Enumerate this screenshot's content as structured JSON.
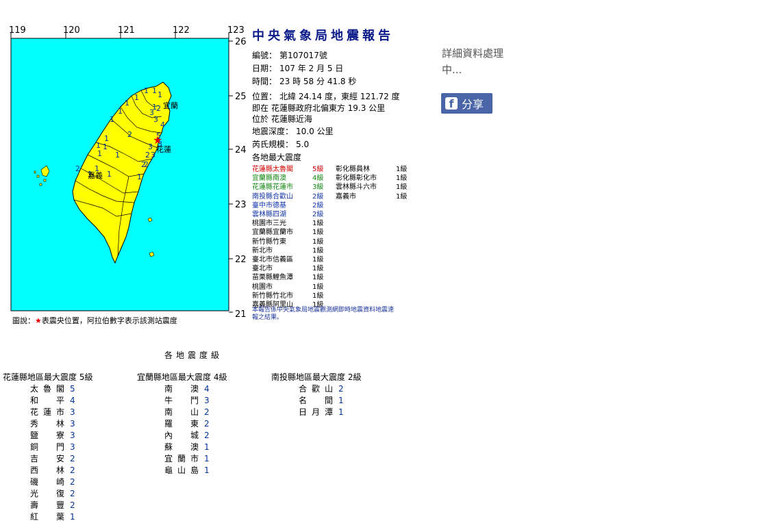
{
  "map": {
    "lon_labels": [
      "119",
      "120",
      "121",
      "122",
      "123"
    ],
    "lat_labels": [
      "26",
      "25",
      "24",
      "23",
      "22",
      "21"
    ],
    "colors": {
      "land": "#ffff00",
      "sea": "#00ffff",
      "star": "#e00000",
      "station": "#003399"
    },
    "city_labels": [
      "宜蘭",
      "花蓮",
      "嘉義"
    ],
    "legend_prefix": "圖說：",
    "legend_star": "★",
    "legend_text": "表震央位置，阿拉伯數字表示該測站震度"
  },
  "report": {
    "title": "中央氣象局地震報告",
    "rows": [
      {
        "k": "編號：",
        "v": "第107017號"
      },
      {
        "k": "日期：",
        "v": "107 年 2 月 5 日"
      },
      {
        "k": "時間：",
        "v": "23 時 58 分 41.8 秒"
      },
      {
        "k": "位置：",
        "v": "北緯 24.14 度，東經 121.72 度"
      },
      {
        "k": "",
        "v": "即在 花蓮縣政府北偏東方 19.3 公里"
      },
      {
        "k": "",
        "v": "位於 花蓮縣近海"
      },
      {
        "k": "地震深度：",
        "v": "10.0 公里"
      },
      {
        "k": "芮氏規模：",
        "v": "5.0"
      },
      {
        "k": "",
        "v": "各地最大震度"
      }
    ],
    "intensity_col1": [
      {
        "name": "花蓮縣太魯閣",
        "level": "5級",
        "color": "#d40000"
      },
      {
        "name": "宜蘭縣南澳",
        "level": "4級",
        "color": "#118811"
      },
      {
        "name": "花蓮縣花蓮市",
        "level": "3級",
        "color": "#118811"
      },
      {
        "name": "南投縣合歡山",
        "level": "2級",
        "color": "#1133aa"
      },
      {
        "name": "臺中市德基",
        "level": "2級",
        "color": "#1133aa"
      },
      {
        "name": "雲林縣四湖",
        "level": "2級",
        "color": "#1133aa"
      },
      {
        "name": "桃園市三光",
        "level": "1級",
        "color": "#000000"
      },
      {
        "name": "宜蘭縣宜蘭市",
        "level": "1級",
        "color": "#000000"
      },
      {
        "name": "新竹縣竹東",
        "level": "1級",
        "color": "#000000"
      },
      {
        "name": "新北市",
        "level": "1級",
        "color": "#000000"
      },
      {
        "name": "臺北市信義區",
        "level": "1級",
        "color": "#000000"
      },
      {
        "name": "臺北市",
        "level": "1級",
        "color": "#000000"
      },
      {
        "name": "苗栗縣鯉魚潭",
        "level": "1級",
        "color": "#000000"
      },
      {
        "name": "桃園市",
        "level": "1級",
        "color": "#000000"
      },
      {
        "name": "新竹縣竹北市",
        "level": "1級",
        "color": "#000000"
      },
      {
        "name": "嘉義縣阿里山",
        "level": "1級",
        "color": "#000000"
      }
    ],
    "intensity_col2": [
      {
        "name": "彰化縣員林",
        "level": "1級",
        "color": "#000000"
      },
      {
        "name": "彰化縣彰化市",
        "level": "1級",
        "color": "#000000"
      },
      {
        "name": "雲林縣斗六市",
        "level": "1級",
        "color": "#000000"
      },
      {
        "name": "嘉義市",
        "level": "1級",
        "color": "#000000"
      }
    ],
    "note": "本報告係中央氣象局地震觀測網即時地震資料地震速報之結果。"
  },
  "side": {
    "detail_text": "詳細資料處理中...",
    "share_label": "分享"
  },
  "levels": {
    "title": "各地震度級",
    "regions": [
      {
        "header": "花蓮縣地區最大震度  5級",
        "stations": [
          {
            "n": "太魯閣",
            "v": "5"
          },
          {
            "n": "和平",
            "v": "4"
          },
          {
            "n": "花蓮市",
            "v": "3"
          },
          {
            "n": "秀林",
            "v": "3"
          },
          {
            "n": "鹽寮",
            "v": "3"
          },
          {
            "n": "銅門",
            "v": "3"
          },
          {
            "n": "吉安",
            "v": "2"
          },
          {
            "n": "西林",
            "v": "2"
          },
          {
            "n": "磯崎",
            "v": "2"
          },
          {
            "n": "光復",
            "v": "2"
          },
          {
            "n": "壽豐",
            "v": "2"
          },
          {
            "n": "紅葉",
            "v": "1"
          }
        ]
      },
      {
        "header": "宜蘭縣地區最大震度  4級",
        "stations": [
          {
            "n": "南澳",
            "v": "4"
          },
          {
            "n": "牛鬥",
            "v": "3"
          },
          {
            "n": "南山",
            "v": "2"
          },
          {
            "n": "羅東",
            "v": "2"
          },
          {
            "n": "內城",
            "v": "2"
          },
          {
            "n": "蘇澳",
            "v": "1"
          },
          {
            "n": "宜蘭市",
            "v": "1"
          },
          {
            "n": "龜山島",
            "v": "1"
          }
        ]
      },
      {
        "header": "南投縣地區最大震度  2級",
        "stations": [
          {
            "n": "合歡山",
            "v": "2"
          },
          {
            "n": "名間",
            "v": "1"
          },
          {
            "n": "日月潭",
            "v": "1"
          }
        ]
      }
    ]
  }
}
